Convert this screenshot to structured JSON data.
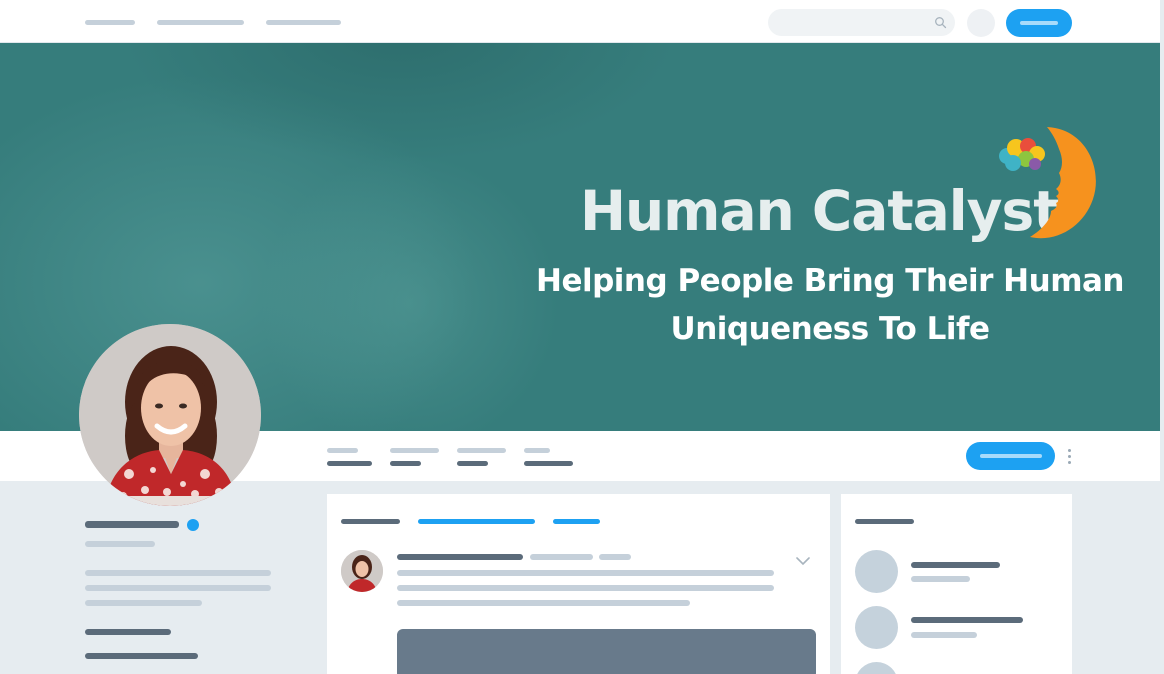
{
  "banner": {
    "brand_name": "Human Catalyst",
    "tagline_line1": "Helping People Bring Their Human",
    "tagline_line2": "Uniqueness To Life",
    "background_color": "#367d7c",
    "logo_colors": [
      "#f6921e",
      "#f7c51e",
      "#e94e3c",
      "#3fb3c6",
      "#8dc63f",
      "#8a5aa8"
    ]
  },
  "icons": {
    "search": "search-icon",
    "more": "more-vertical-icon",
    "expand": "chevron-down-icon"
  },
  "colors": {
    "accent": "#1da1f2",
    "placeholder_light": "#c5d0da",
    "placeholder_dark": "#5b6b7a",
    "page_background": "#e6ecf0"
  }
}
